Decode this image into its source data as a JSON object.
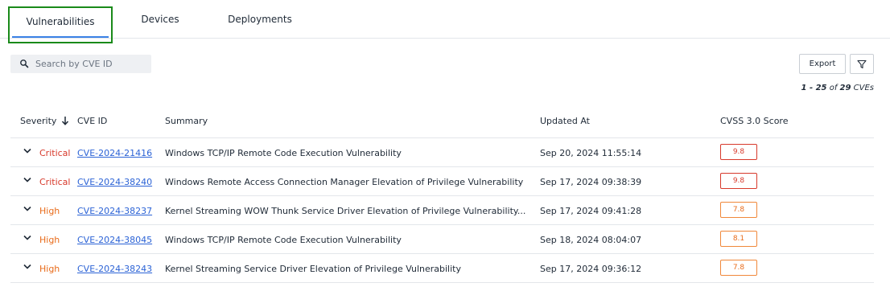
{
  "tabs": [
    {
      "label": "Vulnerabilities",
      "active": true
    },
    {
      "label": "Devices",
      "active": false
    },
    {
      "label": "Deployments",
      "active": false
    }
  ],
  "search": {
    "placeholder": "Search by CVE ID",
    "value": ""
  },
  "toolbar": {
    "export_label": "Export"
  },
  "pagination": {
    "range": "1 - 25",
    "of": "of",
    "total": "29",
    "unit": "CVEs"
  },
  "table": {
    "headers": {
      "severity": "Severity",
      "cve_id": "CVE ID",
      "summary": "Summary",
      "updated_at": "Updated At",
      "cvss": "CVSS 3.0 Score"
    },
    "rows": [
      {
        "severity": "Critical",
        "level": "critical",
        "cve_id": "CVE-2024-21416",
        "summary": "Windows TCP/IP Remote Code Execution Vulnerability",
        "updated_at": "Sep 20, 2024 11:55:14",
        "cvss": "9.8"
      },
      {
        "severity": "Critical",
        "level": "critical",
        "cve_id": "CVE-2024-38240",
        "summary": "Windows Remote Access Connection Manager Elevation of Privilege Vulnerability",
        "updated_at": "Sep 17, 2024 09:38:39",
        "cvss": "9.8"
      },
      {
        "severity": "High",
        "level": "high",
        "cve_id": "CVE-2024-38237",
        "summary": "Kernel Streaming WOW Thunk Service Driver Elevation of Privilege Vulnerability...",
        "updated_at": "Sep 17, 2024 09:41:28",
        "cvss": "7.8"
      },
      {
        "severity": "High",
        "level": "high",
        "cve_id": "CVE-2024-38045",
        "summary": "Windows TCP/IP Remote Code Execution Vulnerability",
        "updated_at": "Sep 18, 2024 08:04:07",
        "cvss": "8.1"
      },
      {
        "severity": "High",
        "level": "high",
        "cve_id": "CVE-2024-38243",
        "summary": "Kernel Streaming Service Driver Elevation of Privilege Vulnerability",
        "updated_at": "Sep 17, 2024 09:36:12",
        "cvss": "7.8"
      }
    ]
  },
  "colors": {
    "critical": "#d7392b",
    "high": "#e86b1a",
    "link": "#2c63d6",
    "active_tab_underline": "#3b82e6",
    "highlight_box": "#1a8a1a"
  },
  "icons": {
    "search": "search-icon",
    "filter": "filter-icon",
    "sort": "arrow-down-icon",
    "expand": "chevron-down-icon"
  }
}
